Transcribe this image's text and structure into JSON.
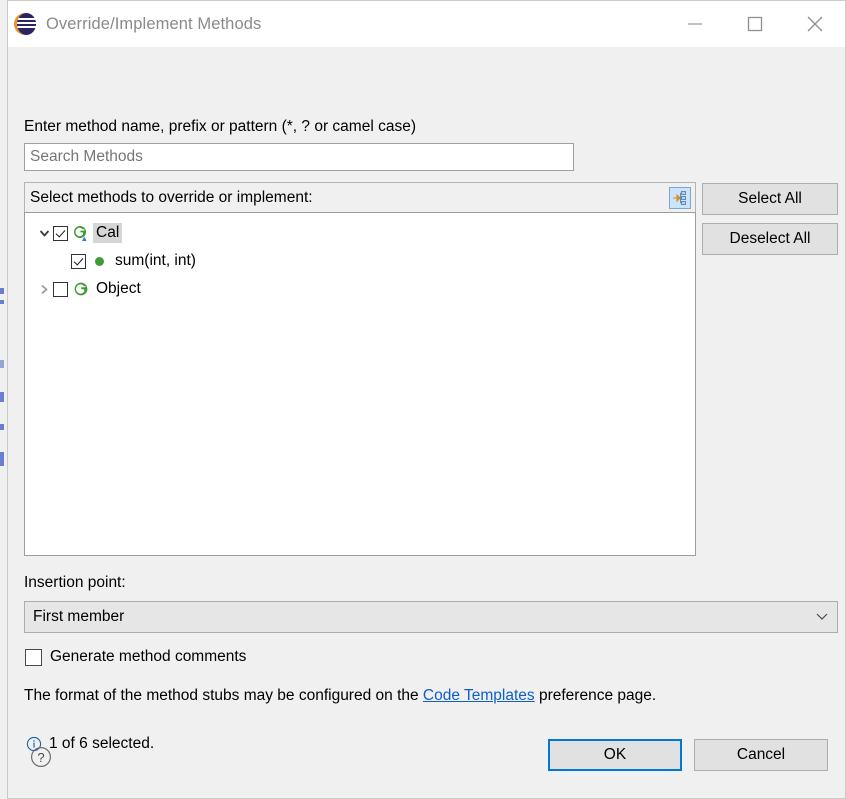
{
  "window": {
    "title": "Override/Implement Methods",
    "app_icon": "eclipse-logo-icon",
    "controls": {
      "minimize": "minimize-icon",
      "maximize": "maximize-icon",
      "close": "close-icon"
    }
  },
  "search": {
    "label": "Enter method name, prefix or pattern (*, ? or camel case)",
    "placeholder": "Search Methods",
    "value": ""
  },
  "list": {
    "header": "Select methods to override or implement:",
    "toolbar_icon": "link-with-editor-icon",
    "rows": [
      {
        "label": "Cal",
        "icon": "java-class-with-override-icon",
        "checked": true,
        "expanded": true,
        "selected": true,
        "level": 0,
        "has_twisty": true
      },
      {
        "label": "sum(int, int)",
        "icon": "public-method-icon",
        "checked": true,
        "expanded": false,
        "selected": false,
        "level": 1,
        "has_twisty": false
      },
      {
        "label": "Object",
        "icon": "java-class-icon",
        "checked": false,
        "expanded": false,
        "selected": false,
        "level": 0,
        "has_twisty": true
      }
    ]
  },
  "buttons": {
    "select_all": "Select All",
    "deselect_all": "Deselect All",
    "ok": "OK",
    "cancel": "Cancel",
    "help_icon": "help-question-icon"
  },
  "insertion": {
    "label": "Insertion point:",
    "selected": "First member",
    "chevron": "chevron-down-icon"
  },
  "options": {
    "generate_comments_label": "Generate method comments",
    "generate_comments_checked": false
  },
  "note": {
    "before": "The format of the method stubs may be configured on the ",
    "link": "Code Templates",
    "after": " preference page."
  },
  "status": {
    "icon": "info-icon",
    "text": "1 of 6 selected."
  },
  "colors": {
    "accent": "#0078d7",
    "link": "#0f5ec9",
    "icon_green": "#3f9c35",
    "selection": "#d6d6d6",
    "dialog_bg": "#f0f0f0"
  }
}
